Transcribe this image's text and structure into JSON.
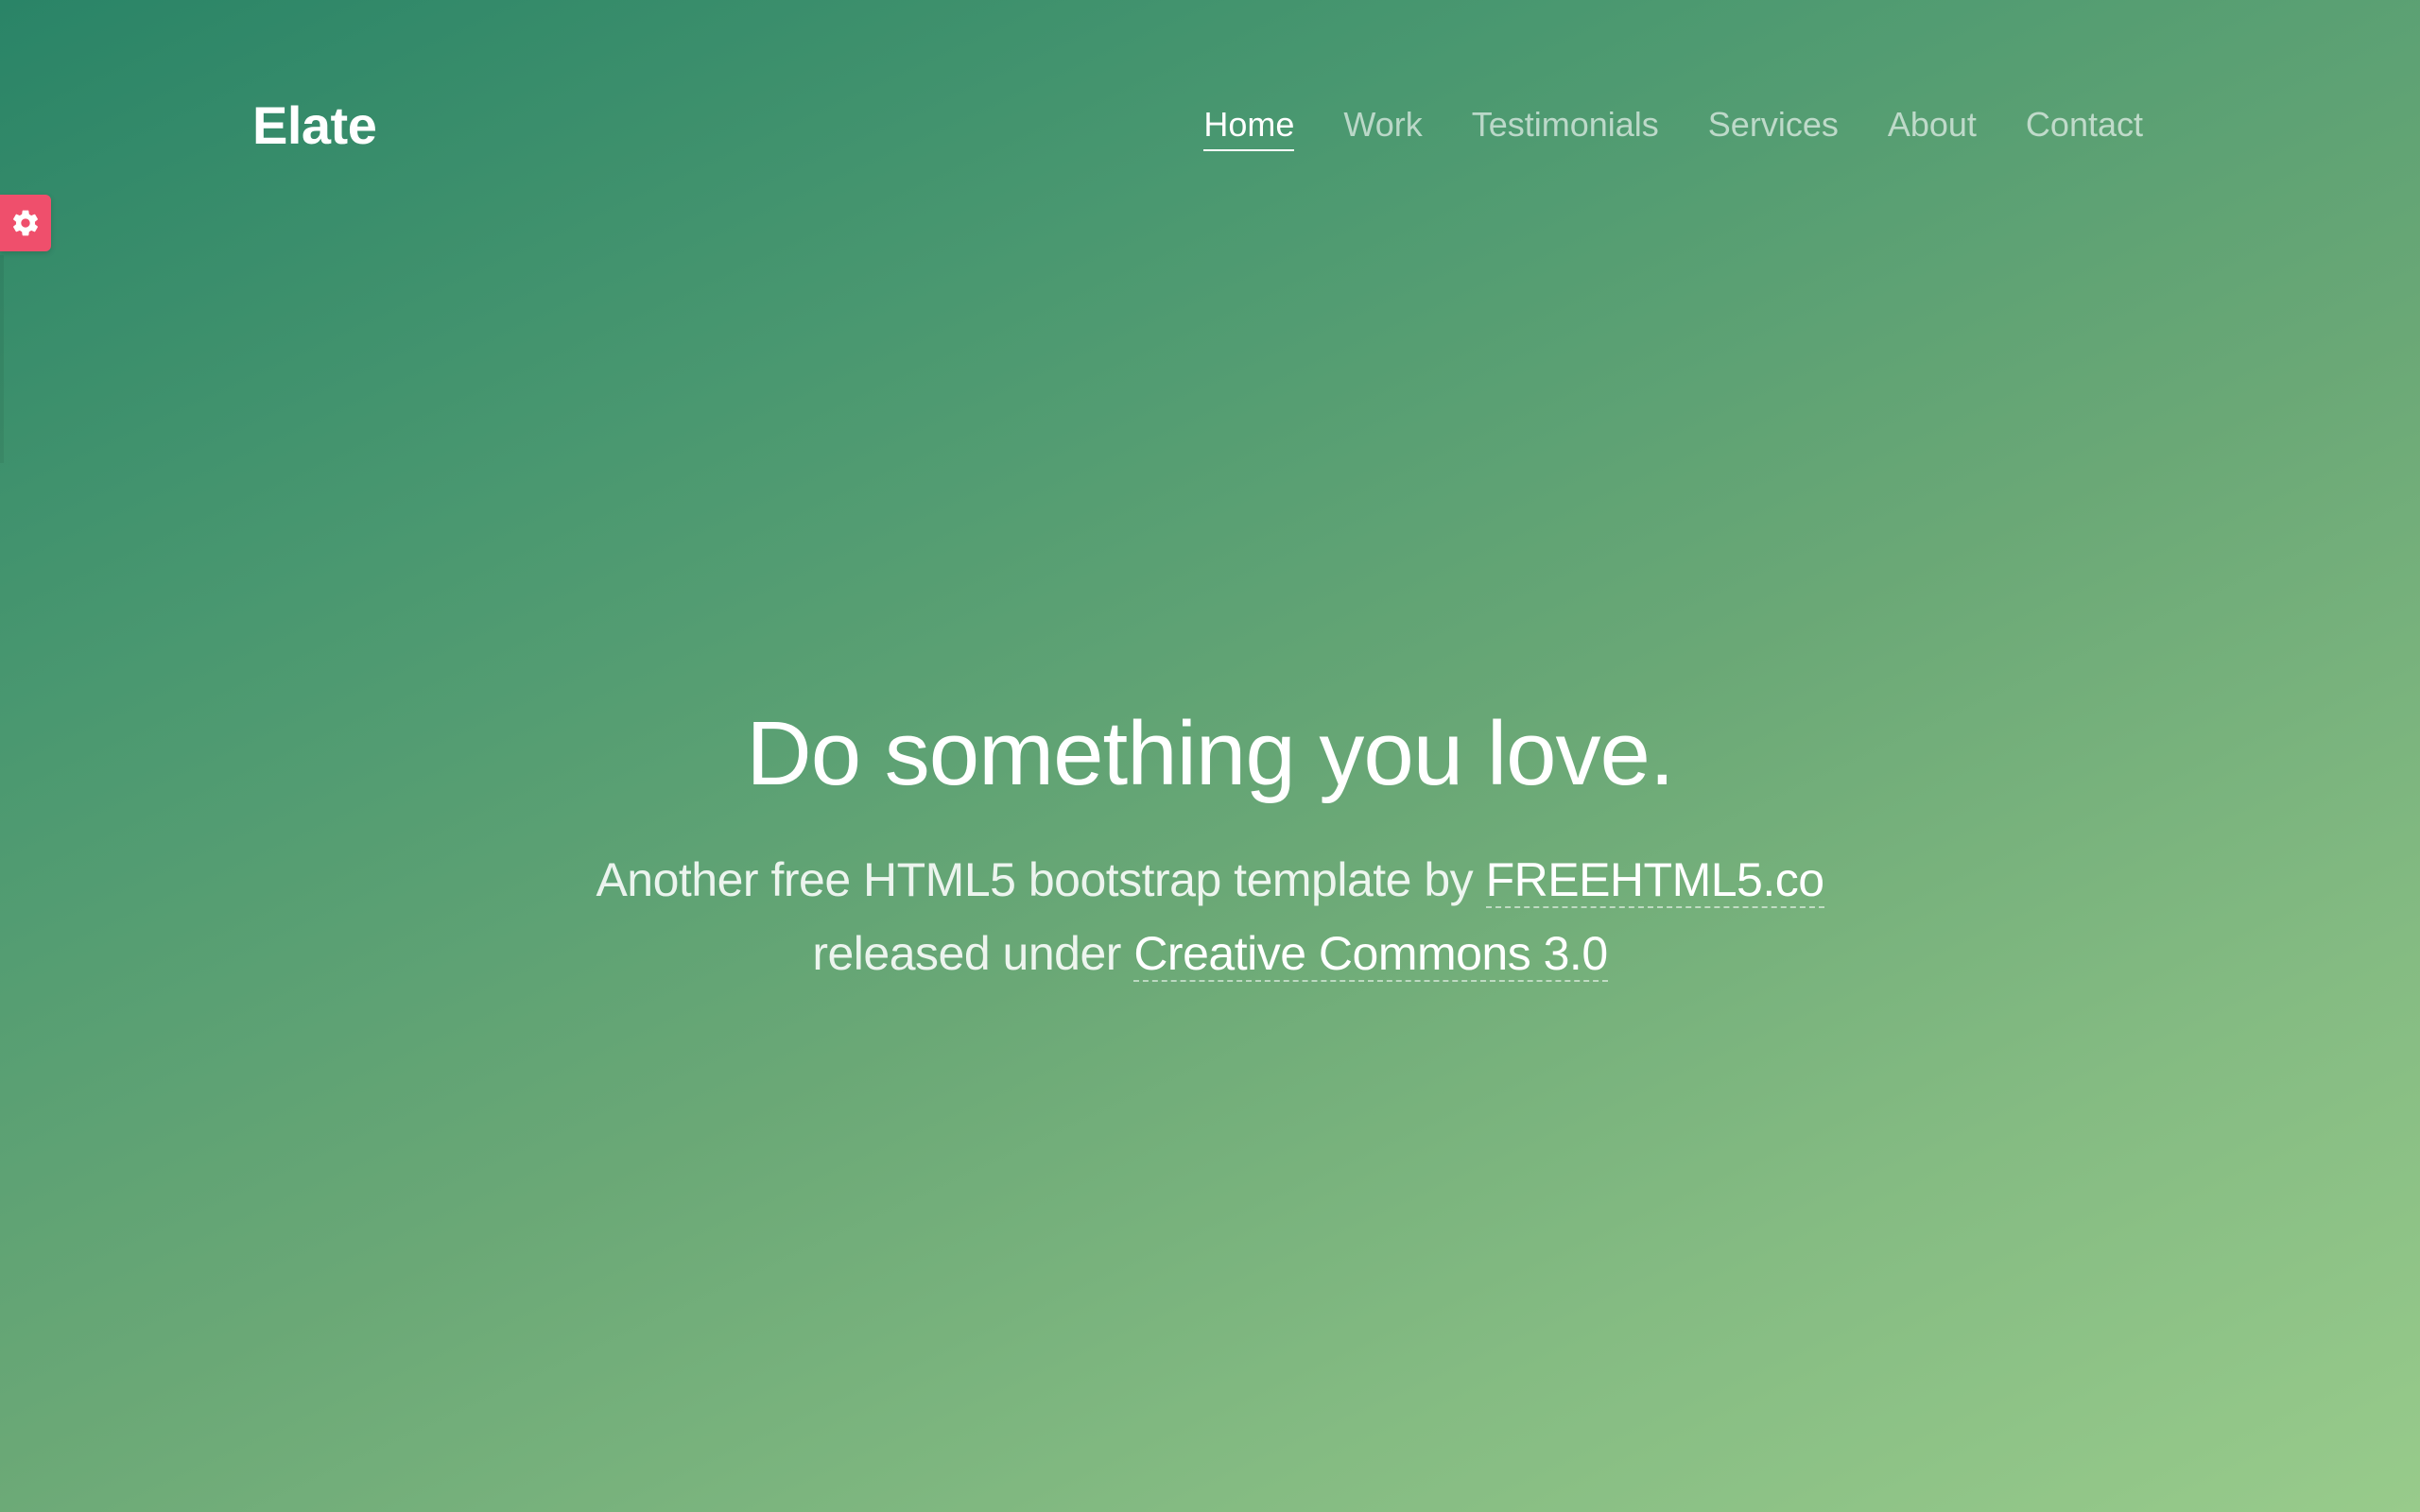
{
  "brand": {
    "name": "Elate"
  },
  "nav": {
    "items": [
      {
        "label": "Home",
        "active": true
      },
      {
        "label": "Work"
      },
      {
        "label": "Testimonials"
      },
      {
        "label": "Services"
      },
      {
        "label": "About"
      },
      {
        "label": "Contact"
      }
    ]
  },
  "settings": {
    "icon": "gear-icon",
    "color": "#ef4f6c"
  },
  "hero": {
    "title": "Do something you love.",
    "line1_prefix": "Another free HTML5 bootstrap template by",
    "line1_link": "FREEHTML5.co",
    "line2_prefix": "released under",
    "line2_link": "Creative Commons 3.0"
  },
  "colors": {
    "gradient_start": "#2a8467",
    "gradient_end": "#98cb8b",
    "text": "#ffffff"
  }
}
